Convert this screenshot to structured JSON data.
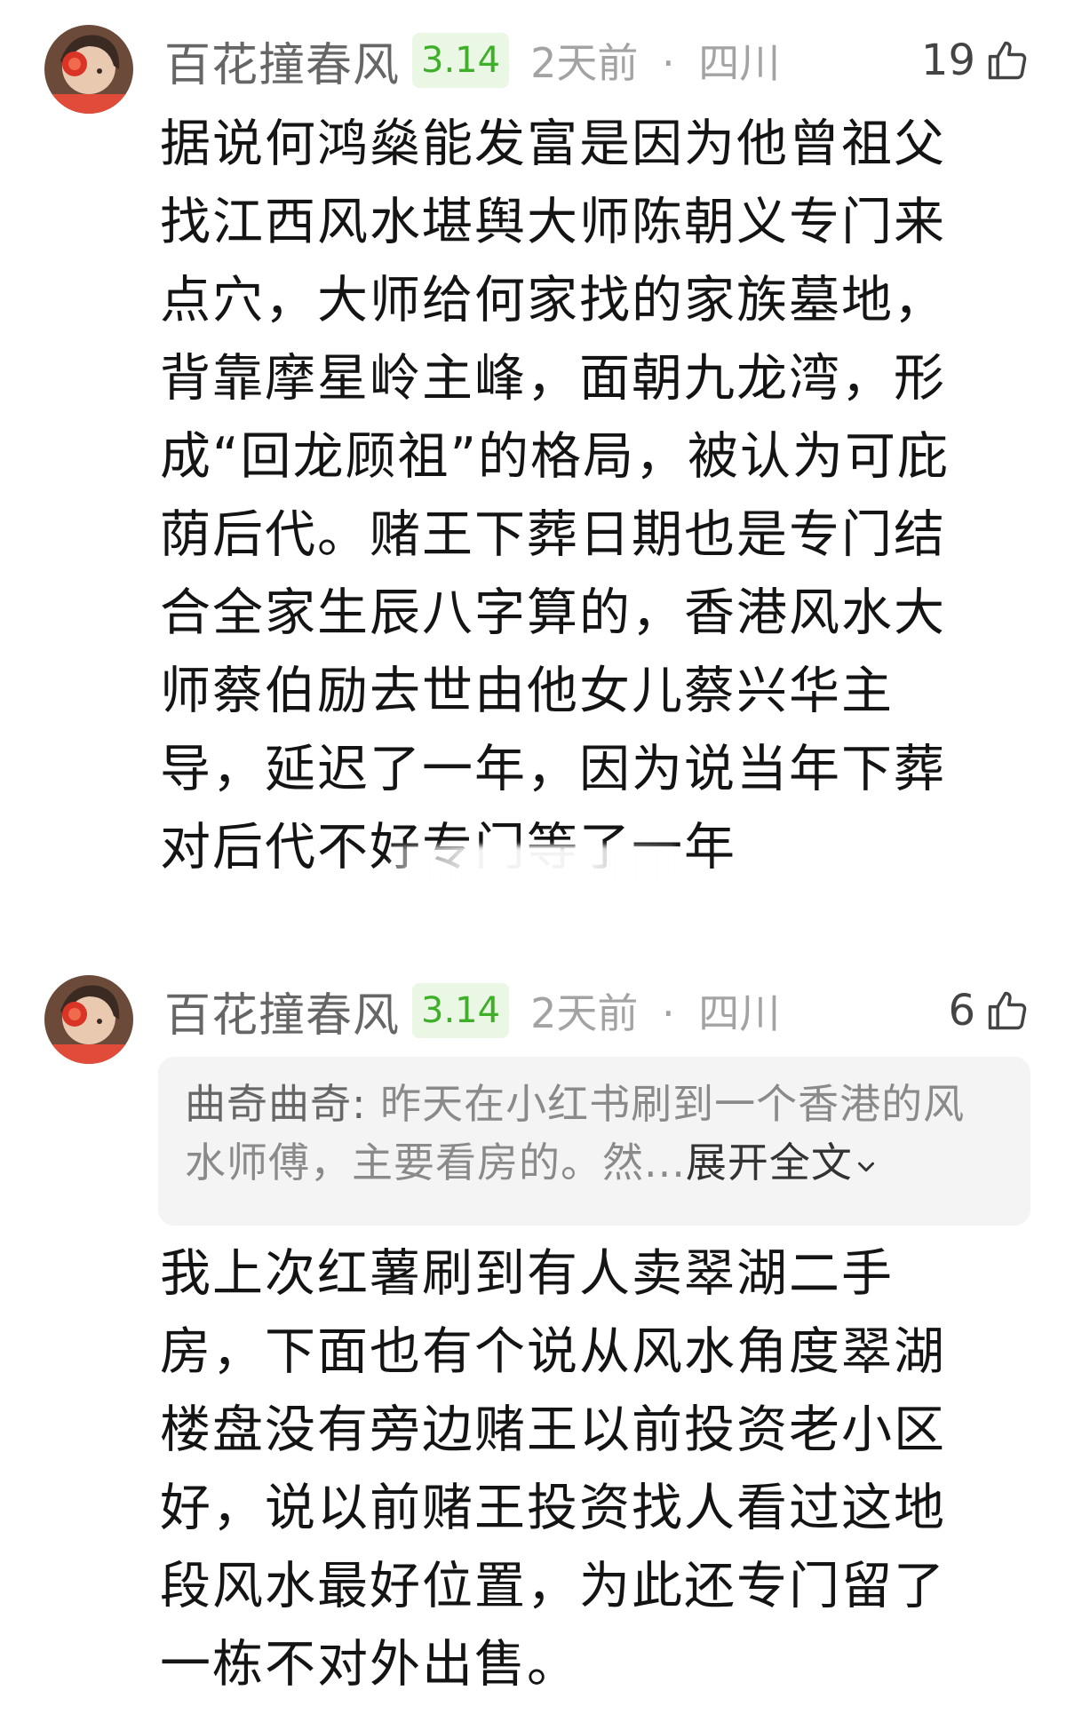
{
  "comments": [
    {
      "username": "百花撞春风",
      "level": "3.14",
      "time": "2天前",
      "separator": "·",
      "location": "四川",
      "likes": "19",
      "text": "据说何鸿燊能发富是因为他曾祖父找江西风水堪舆大师陈朝义专门来点穴，大师给何家找的家族墓地，背靠摩星岭主峰，面朝九龙湾，形成“回龙顾祖”的格局，被认为可庇荫后代。赌王下葬日期也是专门结合全家生辰八字算的，香港风水大师蔡伯励去世由他女儿蔡兴华主导，延迟了一年，因为说当年下葬对后代不好专门等了一年"
    },
    {
      "username": "百花撞春风",
      "level": "3.14",
      "time": "2天前",
      "separator": "·",
      "location": "四川",
      "likes": "6",
      "quote": {
        "author": "曲奇曲奇:",
        "text": "昨天在小红书刷到一个香港的风水师傅，主要看房的。然...",
        "expand": "展开全文"
      },
      "text": "我上次红薯刷到有人卖翠湖二手房，下面也有个说从风水角度翠湖楼盘没有旁边赌王以前投资老小区好，说以前赌王投资找人看过这地段风水最好位置，为此还专门留了一栋不对外出售。"
    }
  ],
  "colors": {
    "username": "#666666",
    "badge_text": "#3fae29",
    "badge_bg": "#eaf7e4",
    "meta": "#a3a3a3",
    "body": "#141414",
    "quote_bg": "#f4f4f4"
  },
  "icons": {
    "avatar": "avatar-girl-with-red-flower",
    "like": "thumbs-up-outline-icon",
    "expand": "chevron-down-icon"
  }
}
